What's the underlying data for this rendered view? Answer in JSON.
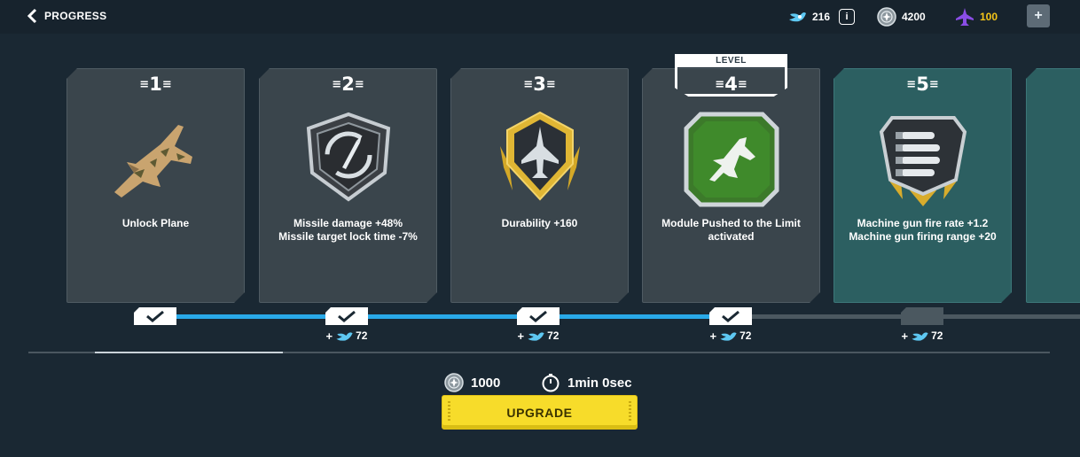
{
  "header": {
    "back_label": "PROGRESS",
    "currencies": [
      {
        "icon": "fuel-icon",
        "value": "216"
      },
      {
        "icon": "silver-coin-icon",
        "value": "4200"
      },
      {
        "icon": "purple-jet-icon",
        "value": "100",
        "color": "#f5c518"
      }
    ],
    "info_label": "i",
    "add_label": "+"
  },
  "level_banner": "LEVEL",
  "cards": [
    {
      "num": "1",
      "icon": "camo-jet-icon",
      "text": "Unlock Plane",
      "state": "unlocked"
    },
    {
      "num": "2",
      "icon": "missile-emblem-icon",
      "text": "Missile damage +48%\nMissile target lock time -7%",
      "state": "unlocked"
    },
    {
      "num": "3",
      "icon": "durability-emblem-icon",
      "text": "Durability +160",
      "state": "unlocked"
    },
    {
      "num": "4",
      "icon": "module-jet-emblem-icon",
      "text": "Module Pushed to the Limit\nactivated",
      "state": "unlocked"
    },
    {
      "num": "5",
      "icon": "machine-gun-emblem-icon",
      "text": "Machine gun fire rate +1.2\nMachine gun firing range +20",
      "state": "next"
    }
  ],
  "rewards": [
    {
      "plus": "+",
      "value": "72"
    },
    {
      "plus": "+",
      "value": "72"
    },
    {
      "plus": "+",
      "value": "72"
    },
    {
      "plus": "+",
      "value": "72"
    }
  ],
  "cost": {
    "amount": "1000",
    "time": "1min 0sec"
  },
  "upgrade_label": "UPGRADE",
  "colors": {
    "accent_blue": "#29a9e8",
    "active_card": "#2c5f61",
    "button": "#f7dc2a"
  }
}
